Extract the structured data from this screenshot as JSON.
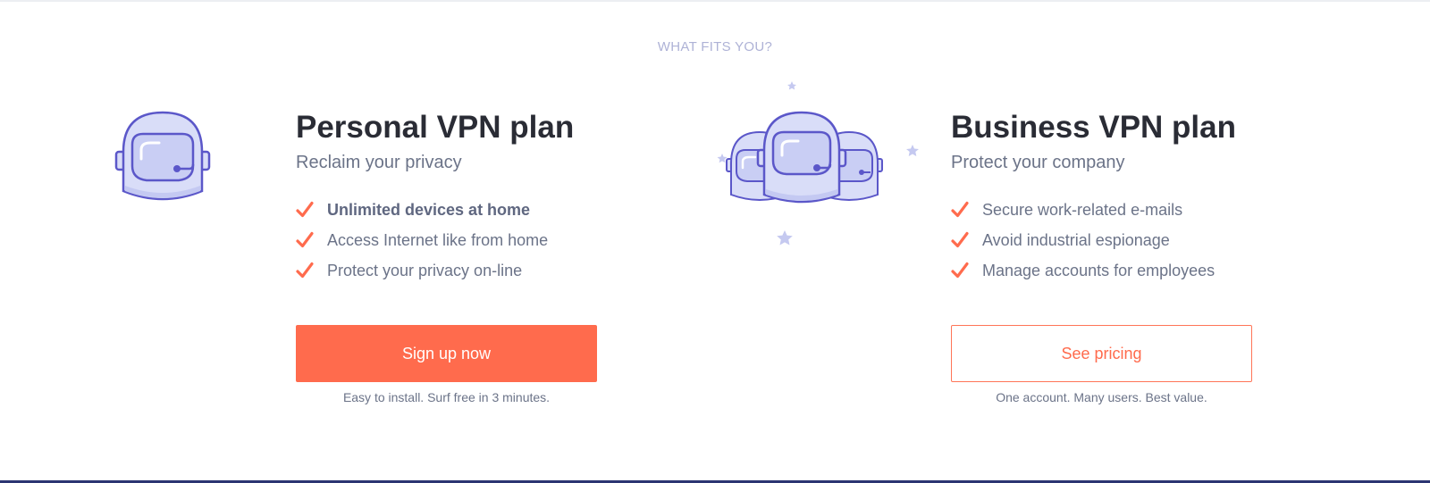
{
  "section": {
    "heading": "WHAT FITS YOU?"
  },
  "personal": {
    "title": "Personal VPN plan",
    "subtitle": "Reclaim your privacy",
    "features": [
      "Unlimited devices at home",
      "Access Internet like from home",
      "Protect your privacy on-line"
    ],
    "cta_label": "Sign up now",
    "cta_note": "Easy to install. Surf free in 3 minutes.",
    "illustration": "single-astronaut-helmet-icon"
  },
  "business": {
    "title": "Business VPN plan",
    "subtitle": "Protect your company",
    "features": [
      "Secure work-related e-mails",
      "Avoid industrial espionage",
      "Manage accounts for employees"
    ],
    "cta_label": "See pricing",
    "cta_note": "One account. Many users. Best value.",
    "illustration": "three-astronaut-helmets-with-stars-icon"
  },
  "colors": {
    "accent": "#ff6b4d",
    "check": "#ff6b4d",
    "title_text": "#2a2c35",
    "body_text": "#6b7388",
    "heading_muted": "#aeb2d6",
    "helmet_fill": "#d9ddf8",
    "helmet_stroke": "#5b57c9",
    "footer_bar": "#2b3572"
  }
}
